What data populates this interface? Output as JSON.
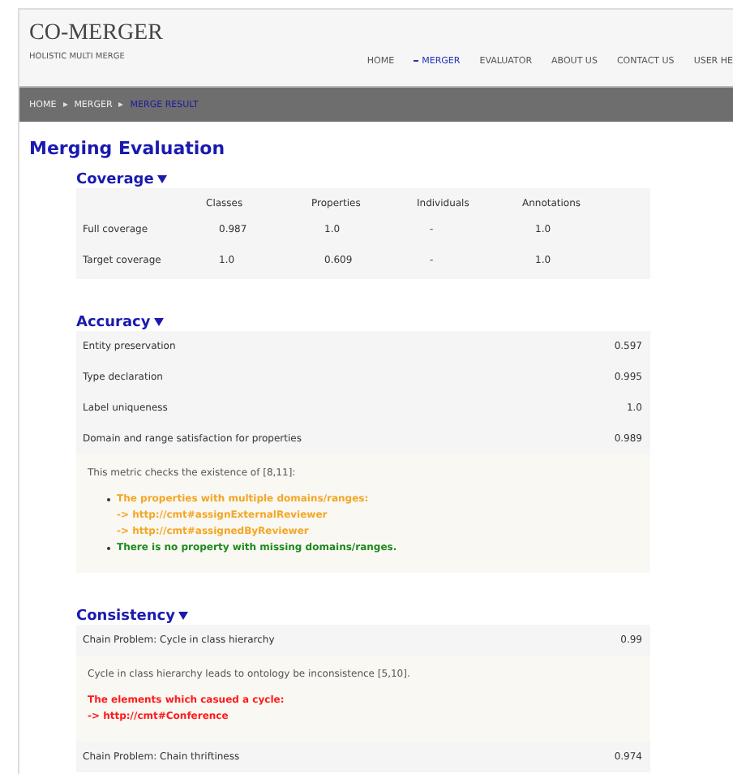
{
  "site": {
    "title": "CO-MERGER",
    "tagline": "HOLISTIC MULTI MERGE"
  },
  "nav": [
    {
      "label": "HOME",
      "selected": false
    },
    {
      "label": "MERGER",
      "selected": true
    },
    {
      "label": "EVALUATOR",
      "selected": false
    },
    {
      "label": "ABOUT US",
      "selected": false
    },
    {
      "label": "CONTACT US",
      "selected": false
    },
    {
      "label": "USER HE",
      "selected": false
    }
  ],
  "breadcrumb": [
    {
      "label": "HOME",
      "selected": false
    },
    {
      "label": "MERGER",
      "selected": false
    },
    {
      "label": "MERGE RESULT",
      "selected": true
    }
  ],
  "page_title": "Merging Evaluation",
  "coverage": {
    "title": "Coverage",
    "expanded": true,
    "columns": [
      "Classes",
      "Properties",
      "Individuals",
      "Annotations"
    ],
    "rows": [
      {
        "label": "Full coverage",
        "cells": [
          "0.987",
          "1.0",
          "-",
          "1.0"
        ]
      },
      {
        "label": "Target coverage",
        "cells": [
          "1.0",
          "0.609",
          "-",
          "1.0"
        ]
      }
    ]
  },
  "sections": [
    {
      "title": "Accuracy",
      "expanded": true,
      "items": [
        {
          "kind": "metric",
          "label": "Entity preservation",
          "value": "0.597"
        },
        {
          "kind": "metric",
          "label": "Type declaration",
          "value": "0.995"
        },
        {
          "kind": "metric",
          "label": "Label uniqueness",
          "value": "1.0"
        },
        {
          "kind": "metric",
          "label": "Domain and range satisfaction for properties",
          "value": "0.989"
        },
        {
          "kind": "note",
          "intro": "This metric checks the existence of [8,11]:",
          "lines": [
            {
              "kind": "bullet",
              "color": "#f5a623",
              "text": "The properties with multiple domains/ranges:"
            },
            {
              "kind": "plain",
              "color": "#f5a623",
              "text": "-> http://cmt#assignExternalReviewer"
            },
            {
              "kind": "plain",
              "color": "#f5a623",
              "text": "-> http://cmt#assignedByReviewer"
            },
            {
              "kind": "bullet",
              "color": "#1e8a1e",
              "text": "There is no property with missing domains/ranges."
            }
          ]
        }
      ]
    },
    {
      "title": "Consistency",
      "expanded": true,
      "items": [
        {
          "kind": "metric",
          "label": "Chain Problem: Cycle in class hierarchy",
          "value": "0.99"
        },
        {
          "kind": "note",
          "intro": "Cycle in class hierarchy leads to ontology be inconsistence [5,10].",
          "lines": [
            {
              "kind": "flush",
              "color": "#ff1a1a",
              "text": "The elements which casued a cycle:"
            },
            {
              "kind": "flush",
              "color": "#ff1a1a",
              "text": "-> http://cmt#Conference"
            }
          ]
        },
        {
          "kind": "metric",
          "label": "Chain Problem: Chain thriftiness",
          "value": "0.974"
        }
      ]
    }
  ]
}
